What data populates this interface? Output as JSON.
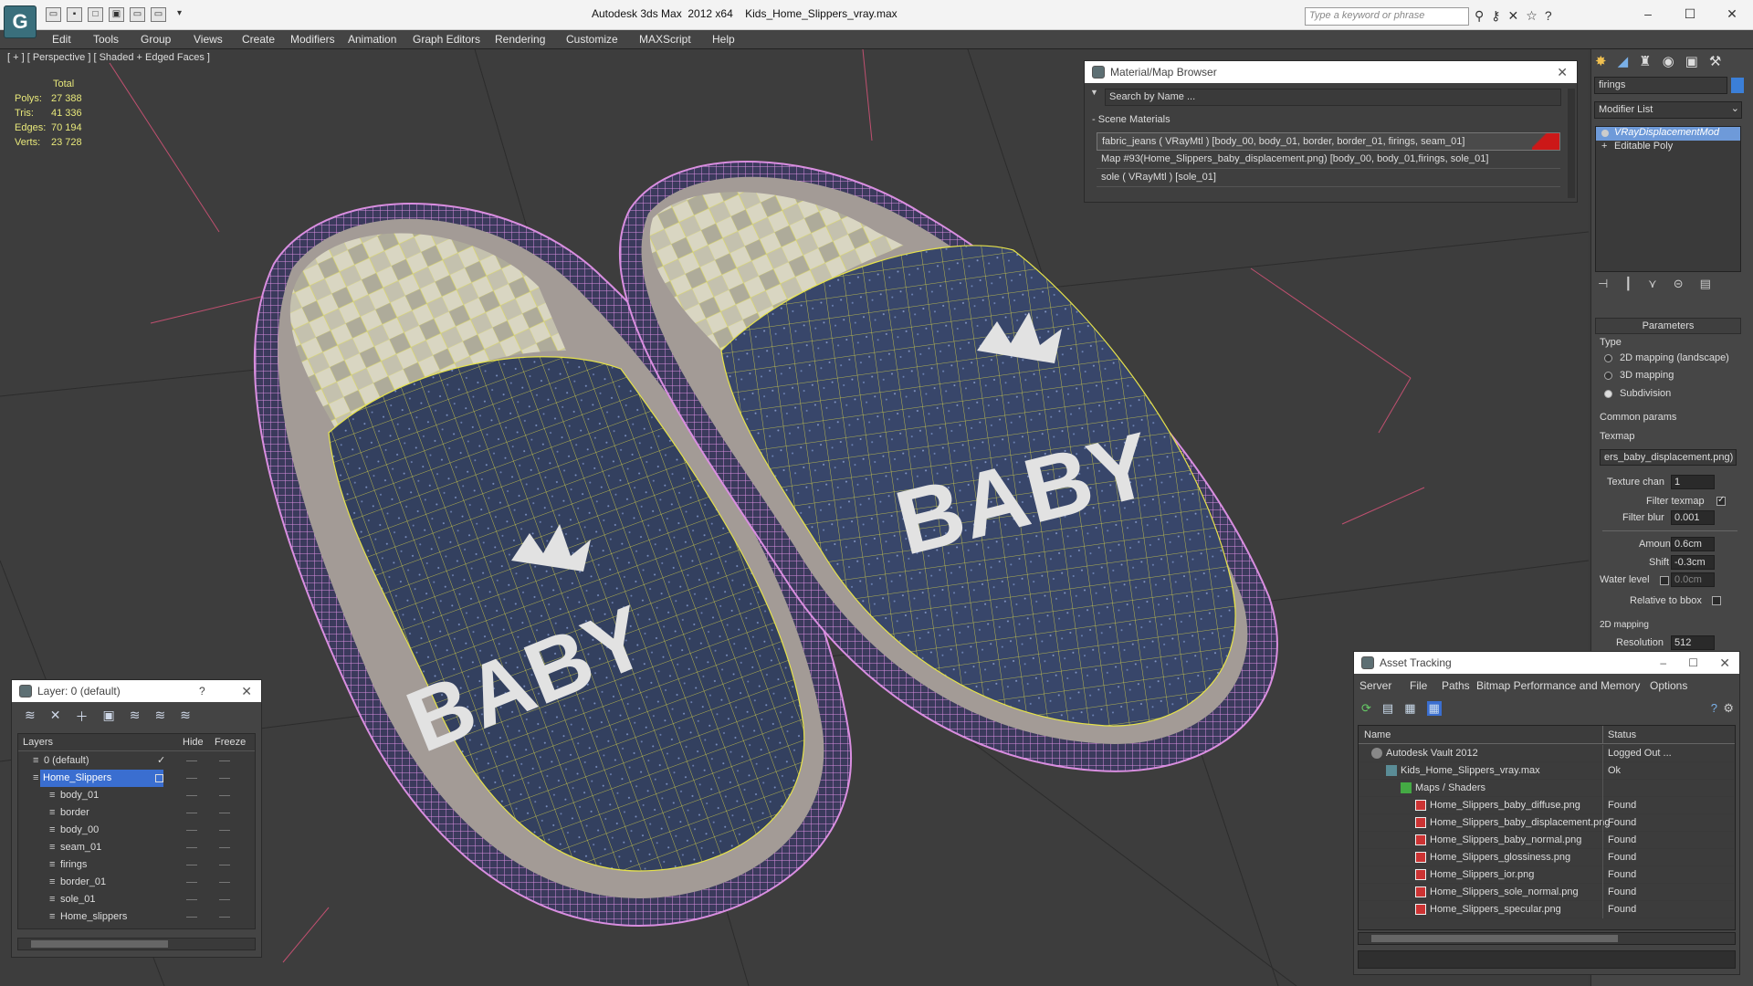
{
  "title": {
    "app": "Autodesk 3ds Max  2012 x64",
    "file": "Kids_Home_Slippers_vray.max",
    "search_placeholder": "Type a keyword or phrase"
  },
  "menu": [
    "Edit",
    "Tools",
    "Group",
    "Views",
    "Create",
    "Modifiers",
    "Animation",
    "Graph Editors",
    "Rendering",
    "Customize",
    "MAXScript",
    "Help"
  ],
  "viewport": {
    "label": "[ + ] [ Perspective ] [ Shaded + Edged Faces ]",
    "stats_header": "Total",
    "stats": [
      {
        "k": "Polys:",
        "v": "27 388"
      },
      {
        "k": "Tris:",
        "v": "41 336"
      },
      {
        "k": "Edges:",
        "v": "70 194"
      },
      {
        "k": "Verts:",
        "v": "23 728"
      }
    ],
    "slipper_text": "BABY"
  },
  "material_browser": {
    "title": "Material/Map Browser",
    "search": "Search by Name ...",
    "section": "Scene Materials",
    "items": [
      "fabric_jeans  ( VRayMtl )  [body_00, body_01, border, border_01, firings, seam_01]",
      "Map #93(Home_Slippers_baby_displacement.png)  [body_00, body_01,firings, sole_01]",
      "sole  ( VRayMtl )  [sole_01]"
    ]
  },
  "command_panel": {
    "object_name": "firings",
    "modifier_list": "Modifier List",
    "stack": [
      "VRayDisplacementMod",
      "Editable Poly"
    ],
    "parameters_title": "Parameters",
    "type_label": "Type",
    "type_options": [
      "2D mapping (landscape)",
      "3D mapping",
      "Subdivision"
    ],
    "type_selected": 2,
    "common_params": "Common params",
    "texmap_label": "Texmap",
    "texmap_value": "ers_baby_displacement.png)",
    "texture_chan_label": "Texture chan",
    "texture_chan_value": "1",
    "filter_texmap_label": "Filter texmap",
    "filter_blur_label": "Filter blur",
    "filter_blur_value": "0.001",
    "amount_label": "Amount",
    "amount_value": "0.6cm",
    "shift_label": "Shift",
    "shift_value": "-0.3cm",
    "water_label": "Water level",
    "water_value": "0.0cm",
    "relative_label": "Relative to bbox",
    "mapping2d": "2D mapping",
    "resolution_label": "Resolution",
    "resolution_value": "512"
  },
  "layers": {
    "title": "Layer: 0 (default)",
    "help": "?",
    "columns": [
      "Layers",
      "Hide",
      "Freeze"
    ],
    "rows": [
      {
        "name": "0 (default)",
        "indent": 1,
        "selected": false
      },
      {
        "name": "Home_Slippers",
        "indent": 1,
        "selected": true
      },
      {
        "name": "body_01",
        "indent": 2,
        "selected": false
      },
      {
        "name": "border",
        "indent": 2,
        "selected": false
      },
      {
        "name": "body_00",
        "indent": 2,
        "selected": false
      },
      {
        "name": "seam_01",
        "indent": 2,
        "selected": false
      },
      {
        "name": "firings",
        "indent": 2,
        "selected": false
      },
      {
        "name": "border_01",
        "indent": 2,
        "selected": false
      },
      {
        "name": "sole_01",
        "indent": 2,
        "selected": false
      },
      {
        "name": "Home_slippers",
        "indent": 2,
        "selected": false
      }
    ]
  },
  "assets": {
    "title": "Asset Tracking",
    "menu": [
      "Server",
      "File",
      "Paths",
      "Bitmap Performance and Memory",
      "Options"
    ],
    "columns": [
      "Name",
      "Status"
    ],
    "rows": [
      {
        "name": "Autodesk Vault 2012",
        "status": "Logged Out ...",
        "indent": 1,
        "icon": "vault"
      },
      {
        "name": "Kids_Home_Slippers_vray.max",
        "status": "Ok",
        "indent": 2,
        "icon": "max"
      },
      {
        "name": "Maps / Shaders",
        "status": "",
        "indent": 3,
        "icon": "folder"
      },
      {
        "name": "Home_Slippers_baby_diffuse.png",
        "status": "Found",
        "indent": 4,
        "icon": "png"
      },
      {
        "name": "Home_Slippers_baby_displacement.png",
        "status": "Found",
        "indent": 4,
        "icon": "png"
      },
      {
        "name": "Home_Slippers_baby_normal.png",
        "status": "Found",
        "indent": 4,
        "icon": "png"
      },
      {
        "name": "Home_Slippers_glossiness.png",
        "status": "Found",
        "indent": 4,
        "icon": "png"
      },
      {
        "name": "Home_Slippers_ior.png",
        "status": "Found",
        "indent": 4,
        "icon": "png"
      },
      {
        "name": "Home_Slippers_sole_normal.png",
        "status": "Found",
        "indent": 4,
        "icon": "png"
      },
      {
        "name": "Home_Slippers_specular.png",
        "status": "Found",
        "indent": 4,
        "icon": "png"
      }
    ]
  },
  "colors": {
    "accent": "#6e9ad9",
    "layer_selected": "#3a6ed0",
    "mesh_wire": "#e6e24a",
    "border_wire": "#d98ee0",
    "denim": "#34405e"
  }
}
